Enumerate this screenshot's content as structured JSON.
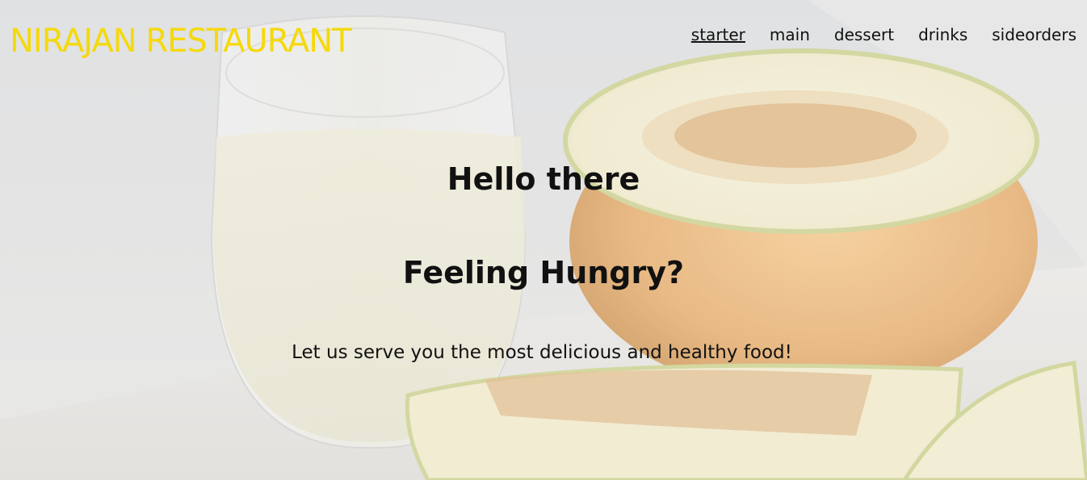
{
  "brand": {
    "name": "NIRAJAN RESTAURANT"
  },
  "nav": {
    "items": [
      {
        "label": "starter",
        "active": true
      },
      {
        "label": "main",
        "active": false
      },
      {
        "label": "dessert",
        "active": false
      },
      {
        "label": "drinks",
        "active": false
      },
      {
        "label": "sideorders",
        "active": false
      }
    ]
  },
  "hero": {
    "greeting": "Hello there",
    "question": "Feeling Hungry?",
    "tagline": "Let us serve you the most delicious and healthy food!"
  },
  "colors": {
    "brand": "#f5d90a",
    "text": "#111111",
    "background": "#dcdcdd"
  }
}
